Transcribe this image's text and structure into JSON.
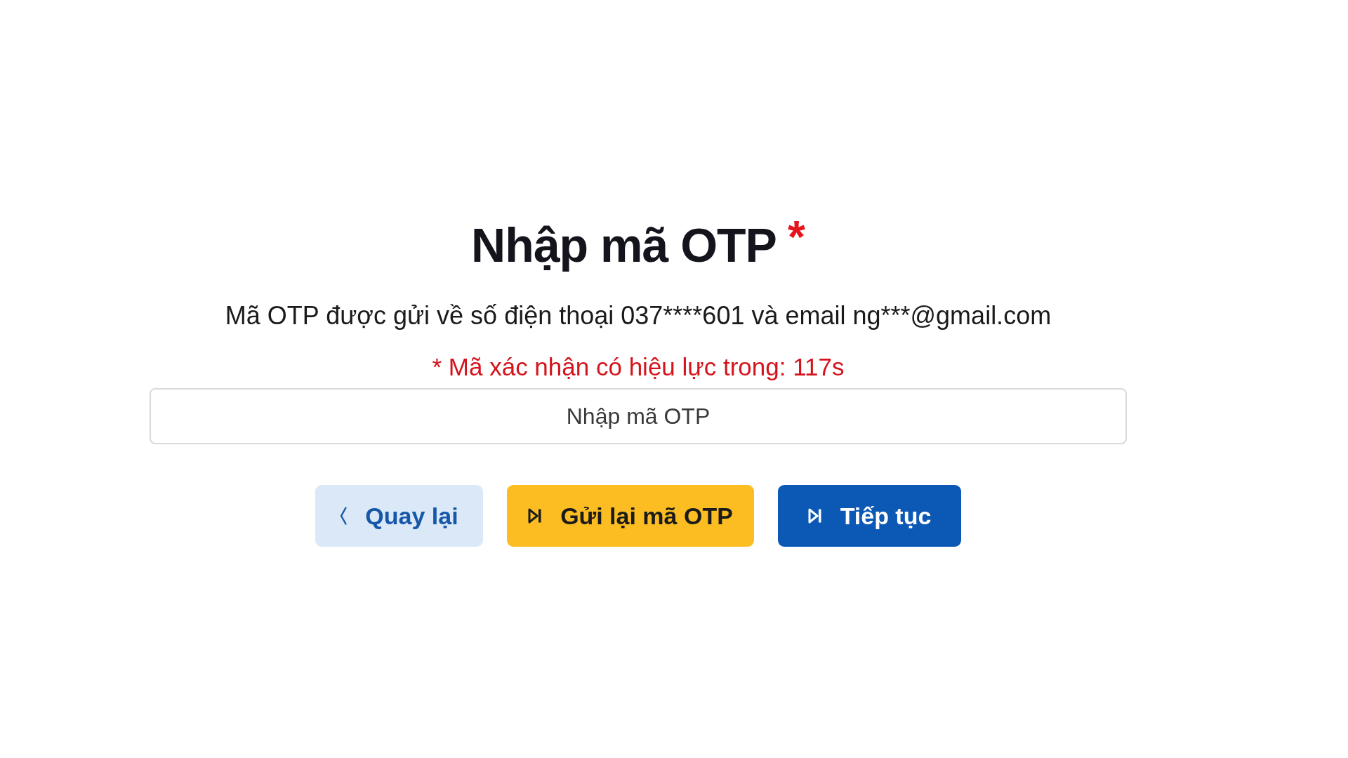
{
  "title": {
    "text": "Nhập mã OTP",
    "required_mark": "*"
  },
  "description": "Mã OTP được gửi về số điện thoại 037****601 và email ng***@gmail.com",
  "validity_note": "* Mã xác nhận có hiệu lực trong: 117s",
  "otp_field": {
    "placeholder": "Nhập mã OTP"
  },
  "buttons": [
    {
      "kind": "back",
      "label": "Quay lại"
    },
    {
      "kind": "resend",
      "label": "Gửi lại mã OTP"
    },
    {
      "kind": "continue",
      "label": "Tiếp tục"
    }
  ]
}
